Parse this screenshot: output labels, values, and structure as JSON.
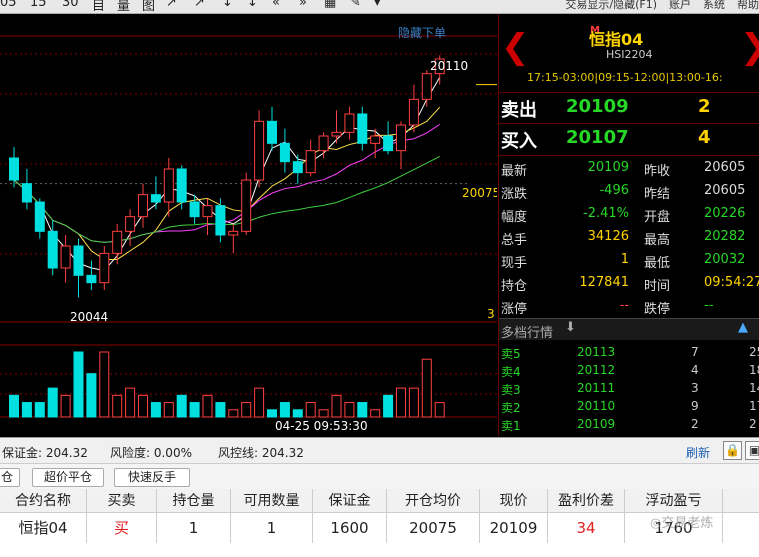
{
  "toolbar": {
    "items": [
      "05",
      "15",
      "30",
      "目",
      "量",
      "图",
      "↗",
      "↗",
      "↓",
      "↓",
      "«",
      "»",
      "▦",
      "✎",
      "▾"
    ],
    "right": [
      "交易显示/隐藏(F1)",
      "账户",
      "系统",
      "帮助"
    ]
  },
  "chart": {
    "hide_order_label": "隐藏下单",
    "high_label": "20110",
    "low_label": "20044",
    "price_label": "20075",
    "right_label": "3",
    "time_label": "04-25 09:53:30",
    "colors": {
      "up": "#ff4040",
      "down": "#00e0e0",
      "ma1": "#ffffff",
      "ma2": "#ffe14a",
      "ma3": "#ff40ff",
      "ma4": "#40d040"
    }
  },
  "chart_data": {
    "type": "candlestick",
    "candles": [
      [
        20082,
        20085,
        20074,
        20076
      ],
      [
        20075,
        20079,
        20068,
        20070
      ],
      [
        20070,
        20071,
        20060,
        20062
      ],
      [
        20062,
        20065,
        20050,
        20052
      ],
      [
        20052,
        20061,
        20048,
        20058
      ],
      [
        20058,
        20060,
        20044,
        20050
      ],
      [
        20050,
        20054,
        20046,
        20048
      ],
      [
        20048,
        20058,
        20046,
        20056
      ],
      [
        20056,
        20064,
        20053,
        20062
      ],
      [
        20062,
        20068,
        20058,
        20066
      ],
      [
        20066,
        20075,
        20063,
        20072
      ],
      [
        20072,
        20077,
        20068,
        20070
      ],
      [
        20070,
        20082,
        20066,
        20079
      ],
      [
        20079,
        20080,
        20068,
        20070
      ],
      [
        20070,
        20072,
        20064,
        20066
      ],
      [
        20066,
        20071,
        20061,
        20069
      ],
      [
        20069,
        20071,
        20059,
        20061
      ],
      [
        20061,
        20064,
        20056,
        20062
      ],
      [
        20062,
        20078,
        20061,
        20076
      ],
      [
        20076,
        20095,
        20074,
        20092
      ],
      [
        20092,
        20096,
        20084,
        20086
      ],
      [
        20086,
        20090,
        20078,
        20081
      ],
      [
        20081,
        20083,
        20075,
        20078
      ],
      [
        20078,
        20087,
        20077,
        20084
      ],
      [
        20084,
        20089,
        20082,
        20088
      ],
      [
        20088,
        20095,
        20086,
        20089
      ],
      [
        20089,
        20096,
        20087,
        20094
      ],
      [
        20094,
        20096,
        20084,
        20086
      ],
      [
        20086,
        20090,
        20082,
        20088
      ],
      [
        20088,
        20092,
        20083,
        20084
      ],
      [
        20084,
        20092,
        20079,
        20091
      ],
      [
        20091,
        20102,
        20089,
        20098
      ],
      [
        20098,
        20106,
        20096,
        20105
      ],
      [
        20105,
        20110,
        20102,
        20109
      ]
    ],
    "volumes": [
      3,
      2,
      2,
      4,
      3,
      9,
      6,
      9,
      3,
      4,
      3,
      2,
      2,
      3,
      2,
      3,
      2,
      1,
      2,
      4,
      1,
      2,
      1,
      2,
      1,
      3,
      2,
      2,
      1,
      3,
      4,
      4,
      8,
      2
    ],
    "ylim": [
      20040,
      20112
    ]
  },
  "quote": {
    "title_mark": "M",
    "title": "恒指04",
    "code": "HSI2204",
    "hours": "17:15-03:00|09:15-12:00|13:00-16:",
    "sell_label": "卖出",
    "sell_price": "20109",
    "sell_vol": "2",
    "buy_label": "买入",
    "buy_price": "20107",
    "buy_vol": "4",
    "stats": [
      {
        "l": "最新",
        "v": "20109",
        "vc": "#25d825",
        "l2": "昨收",
        "v2": "20605",
        "v2c": "#ddd"
      },
      {
        "l": "涨跌",
        "v": "-496",
        "vc": "#25d825",
        "l2": "昨结",
        "v2": "20605",
        "v2c": "#ddd"
      },
      {
        "l": "幅度",
        "v": "-2.41%",
        "vc": "#25d825",
        "l2": "开盘",
        "v2": "20226",
        "v2c": "#25d825"
      },
      {
        "l": "总手",
        "v": "34126",
        "vc": "#ffd400",
        "l2": "最高",
        "v2": "20282",
        "v2c": "#25d825"
      },
      {
        "l": "现手",
        "v": "1",
        "vc": "#ffd400",
        "l2": "最低",
        "v2": "20032",
        "v2c": "#25d825"
      },
      {
        "l": "持仓",
        "v": "127841",
        "vc": "#ffd400",
        "l2": "时间",
        "v2": "09:54:27",
        "v2c": "#ffd400"
      },
      {
        "l": "涨停",
        "v": "--",
        "vc": "#ff4040",
        "l2": "跌停",
        "v2": "--",
        "v2c": "#25d825"
      }
    ],
    "depth_title": "多档行情",
    "depth": [
      {
        "l": "卖5",
        "p": "20113",
        "v": "7",
        "v2": "25"
      },
      {
        "l": "卖4",
        "p": "20112",
        "v": "4",
        "v2": "18"
      },
      {
        "l": "卖3",
        "p": "20111",
        "v": "3",
        "v2": "14"
      },
      {
        "l": "卖2",
        "p": "20110",
        "v": "9",
        "v2": "17"
      },
      {
        "l": "卖1",
        "p": "20109",
        "v": "2",
        "v2": "2"
      }
    ]
  },
  "account": {
    "margin": "保证金: 204.32",
    "risk": "风险度: 0.00%",
    "risk_line": "风控线: 204.32",
    "refresh": "刷新"
  },
  "actions": [
    "仓",
    "超价平仓",
    "快速反手"
  ],
  "positions": {
    "headers": [
      "合约名称",
      "买卖",
      "持仓量",
      "可用数量",
      "保证金",
      "开仓均价",
      "现价",
      "盈利价差",
      "浮动盈亏"
    ],
    "rows": [
      [
        "恒指04",
        "买",
        "1",
        "1",
        "1600",
        "20075",
        "20109",
        "34",
        "1760"
      ]
    ],
    "watermark": "◎交易老炼"
  }
}
